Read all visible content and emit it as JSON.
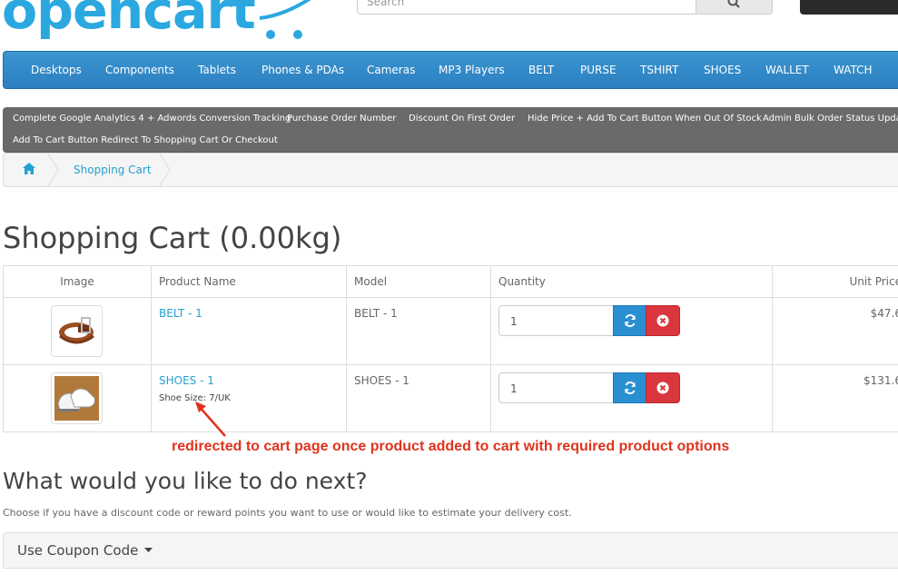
{
  "header": {
    "logo_text": "opencart",
    "search_placeholder": "Search"
  },
  "menu": [
    "Desktops",
    "Components",
    "Tablets",
    "Phones & PDAs",
    "Cameras",
    "MP3 Players",
    "BELT",
    "PURSE",
    "TSHIRT",
    "SHOES",
    "WALLET",
    "WATCH"
  ],
  "extensions": [
    "Complete Google Analytics 4 + Adwords Conversion Tracking",
    "Purchase Order Number",
    "Discount On First Order",
    "Hide Price + Add To Cart Button When Out Of Stock",
    "Admin Bulk Order Status Update",
    "Add To Cart Button Redirect To Shopping Cart Or Checkout"
  ],
  "breadcrumb": {
    "home_icon": "home-icon",
    "current": "Shopping Cart"
  },
  "page": {
    "title": "Shopping Cart  (0.00kg)"
  },
  "table": {
    "headers": [
      "Image",
      "Product Name",
      "Model",
      "Quantity",
      "Unit Price"
    ],
    "rows": [
      {
        "name": "BELT - 1",
        "option": "",
        "model": "BELT - 1",
        "quantity": "1",
        "unit_price": "$47.6",
        "image": "belt-thumbnail"
      },
      {
        "name": "SHOES - 1",
        "option": "Shoe Size: 7/UK",
        "model": "SHOES - 1",
        "quantity": "1",
        "unit_price": "$131.6",
        "image": "shoes-thumbnail"
      }
    ]
  },
  "annotation": "redirected to cart page once product added to cart with required product options",
  "next": {
    "title": "What would you like to do next?",
    "description": "Choose if you have a discount code or reward points you want to use or would like to estimate your delivery cost.",
    "coupon_label": "Use Coupon Code"
  },
  "colors": {
    "brand": "#2ba8e0",
    "menu": "#2d7fc0",
    "link": "#23a1d1",
    "refresh": "#2a8fd0",
    "remove": "#d9363e",
    "annotation": "#e0331d"
  }
}
